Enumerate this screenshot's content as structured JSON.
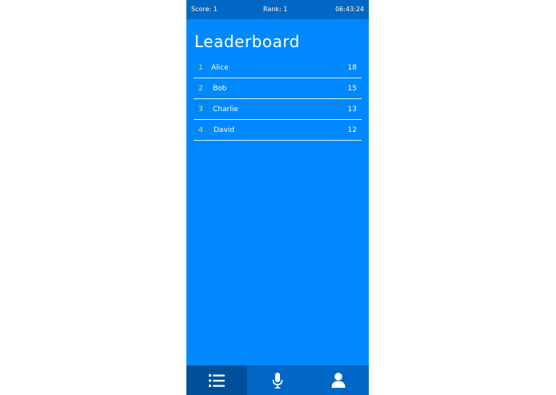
{
  "status": {
    "score": "Score: 1",
    "rank": "Rank: 1",
    "time": "06:43:24"
  },
  "title": "Leaderboard",
  "leaderboard": [
    {
      "rank": "1",
      "name": "Alice",
      "score": "18"
    },
    {
      "rank": "2",
      "name": "Bob",
      "score": "15"
    },
    {
      "rank": "3",
      "name": "Charlie",
      "score": "13"
    },
    {
      "rank": "4",
      "name": "David",
      "score": "12"
    }
  ],
  "nav": [
    {
      "icon": "leaderboard-list-icon",
      "active": true
    },
    {
      "icon": "microphone-icon",
      "active": false
    },
    {
      "icon": "user-profile-icon",
      "active": false
    }
  ],
  "colors": {
    "background": "#0088ff",
    "bars": "#0067c5",
    "active_tab": "#004f9a",
    "rank_accent": "#ffd633",
    "text": "#ffffff"
  }
}
